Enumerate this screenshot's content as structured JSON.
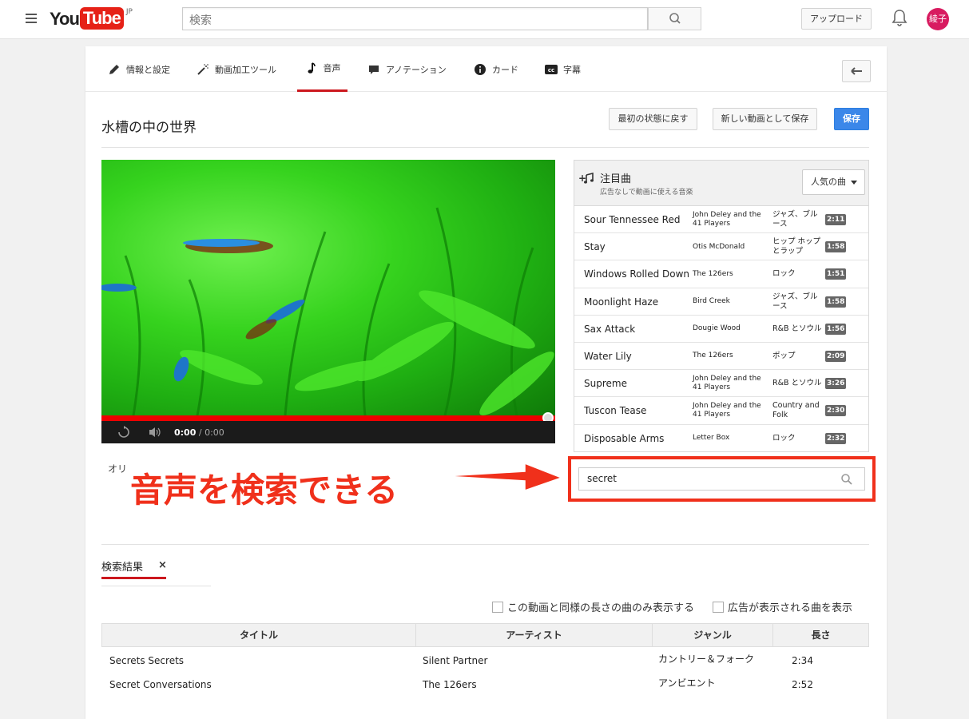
{
  "header": {
    "logo_you": "You",
    "logo_tube": "Tube",
    "logo_region": "JP",
    "search_placeholder": "検索",
    "upload_label": "アップロード",
    "avatar_text": "綾子"
  },
  "tabs": [
    {
      "label": "情報と設定",
      "icon": "pencil-icon",
      "active": false
    },
    {
      "label": "動画加工ツール",
      "icon": "magic-wand-icon",
      "active": false
    },
    {
      "label": "音声",
      "icon": "music-note-icon",
      "active": true
    },
    {
      "label": "アノテーション",
      "icon": "speech-bubble-icon",
      "active": false
    },
    {
      "label": "カード",
      "icon": "info-icon",
      "active": false
    },
    {
      "label": "字幕",
      "icon": "cc-icon",
      "active": false
    }
  ],
  "editor": {
    "video_title": "水槽の中の世界",
    "revert_label": "最初の状態に戻す",
    "save_new_label": "新しい動画として保存",
    "save_label": "保存"
  },
  "player": {
    "current_time": "0:00",
    "duration": "/ 0:00",
    "progress": 1.0
  },
  "original_audio_label": "オリ",
  "music": {
    "title": "注目曲",
    "subtitle": "広告なしで動画に使える音楽",
    "sort_label": "人気の曲",
    "tracks": [
      {
        "title": "Sour Tennessee Red",
        "artist": "John Deley and the 41 Players",
        "genre": "ジャズ、ブルース",
        "duration": "2:11"
      },
      {
        "title": "Stay",
        "artist": "Otis McDonald",
        "genre": "ヒップ ホップとラップ",
        "duration": "1:58"
      },
      {
        "title": "Windows Rolled Down",
        "artist": "The 126ers",
        "genre": "ロック",
        "duration": "1:51"
      },
      {
        "title": "Moonlight Haze",
        "artist": "Bird Creek",
        "genre": "ジャズ、ブルース",
        "duration": "1:58"
      },
      {
        "title": "Sax Attack",
        "artist": "Dougie Wood",
        "genre": "R&B とソウル",
        "duration": "1:56"
      },
      {
        "title": "Water Lily",
        "artist": "The 126ers",
        "genre": "ポップ",
        "duration": "2:09"
      },
      {
        "title": "Supreme",
        "artist": "John Deley and the 41 Players",
        "genre": "R&B とソウル",
        "duration": "3:26"
      },
      {
        "title": "Tuscon Tease",
        "artist": "John Deley and the 41 Players",
        "genre": "Country and Folk",
        "duration": "2:30"
      },
      {
        "title": "Disposable Arms",
        "artist": "Letter Box",
        "genre": "ロック",
        "duration": "2:32"
      }
    ],
    "search_value": "secret"
  },
  "annotation": {
    "text": "音声を検索できる",
    "color": "#f0301b"
  },
  "results": {
    "title": "検索結果",
    "close_symbol": "×",
    "filter_same_length": "この動画と同様の長さの曲のみ表示する",
    "filter_ads": "広告が表示される曲を表示",
    "columns": [
      "タイトル",
      "アーティスト",
      "ジャンル",
      "長さ"
    ],
    "rows": [
      {
        "title": "Secrets Secrets",
        "artist": "Silent Partner",
        "genre": "カントリー＆フォーク",
        "duration": "2:34"
      },
      {
        "title": "Secret Conversations",
        "artist": "The 126ers",
        "genre": "アンビエント",
        "duration": "2:52"
      }
    ]
  },
  "colors": {
    "brand_red": "#e62117",
    "save_blue": "#3b87e9",
    "active_tab": "#cc181e"
  }
}
